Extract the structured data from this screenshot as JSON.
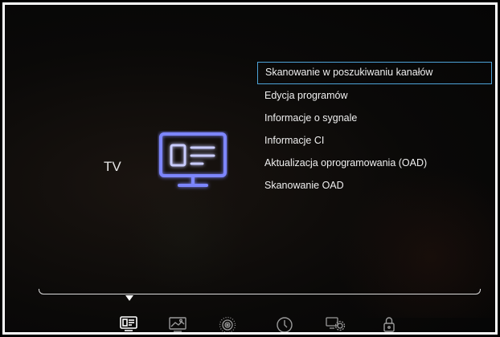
{
  "section": {
    "title": "TV"
  },
  "menu": {
    "items": [
      {
        "label": "Skanowanie w poszukiwaniu kanałów",
        "selected": true
      },
      {
        "label": "Edycja programów",
        "selected": false
      },
      {
        "label": "Informacje o sygnale",
        "selected": false
      },
      {
        "label": "Informacje CI",
        "selected": false
      },
      {
        "label": "Aktualizacja oprogramowania (OAD)",
        "selected": false
      },
      {
        "label": "Skanowanie OAD",
        "selected": false
      }
    ]
  },
  "bottom_nav": {
    "icons": [
      {
        "name": "tv-menu-icon",
        "active": true
      },
      {
        "name": "picture-icon",
        "active": false
      },
      {
        "name": "sound-icon",
        "active": false
      },
      {
        "name": "clock-icon",
        "active": false
      },
      {
        "name": "settings-icon",
        "active": false
      },
      {
        "name": "lock-icon",
        "active": false
      }
    ]
  },
  "colors": {
    "accent": "#4da3d8",
    "icon_glow": "#6f7bff",
    "text": "#f0f0f0"
  }
}
